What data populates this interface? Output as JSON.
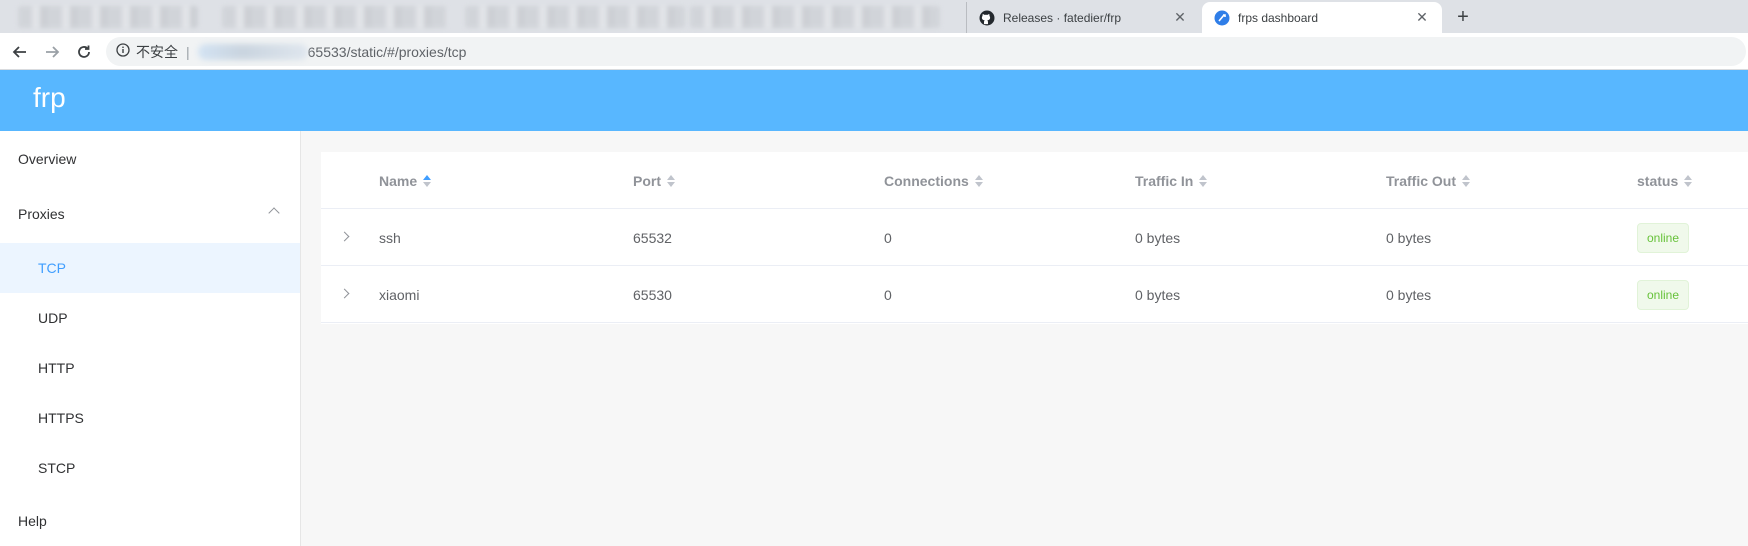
{
  "browser": {
    "tabs": [
      {
        "title": "Releases · fatedier/frp",
        "icon": "github-icon"
      },
      {
        "title": "frps dashboard",
        "icon": "frp-icon",
        "active": true
      }
    ],
    "close_glyph": "✕",
    "new_tab_glyph": "+",
    "security_label": "不安全",
    "separator": "|",
    "url_suffix": "65533/static/#/proxies/tcp"
  },
  "app": {
    "brand": "frp"
  },
  "sidebar": {
    "items": [
      {
        "label": "Overview",
        "level": "top"
      },
      {
        "label": "Proxies",
        "level": "top",
        "expanded": true
      },
      {
        "label": "TCP",
        "level": "sub",
        "active": true
      },
      {
        "label": "UDP",
        "level": "sub"
      },
      {
        "label": "HTTP",
        "level": "sub"
      },
      {
        "label": "HTTPS",
        "level": "sub"
      },
      {
        "label": "STCP",
        "level": "sub"
      },
      {
        "label": "Help",
        "level": "top"
      }
    ]
  },
  "table": {
    "columns": [
      "Name",
      "Port",
      "Connections",
      "Traffic In",
      "Traffic Out",
      "status"
    ],
    "sorted_column": "Name",
    "rows": [
      {
        "name": "ssh",
        "port": "65532",
        "connections": "0",
        "traffic_in": "0 bytes",
        "traffic_out": "0 bytes",
        "status": "online"
      },
      {
        "name": "xiaomi",
        "port": "65530",
        "connections": "0",
        "traffic_in": "0 bytes",
        "traffic_out": "0 bytes",
        "status": "online"
      }
    ]
  },
  "colors": {
    "header": "#58b7ff",
    "accent": "#409eff",
    "online": "#67c23a"
  }
}
